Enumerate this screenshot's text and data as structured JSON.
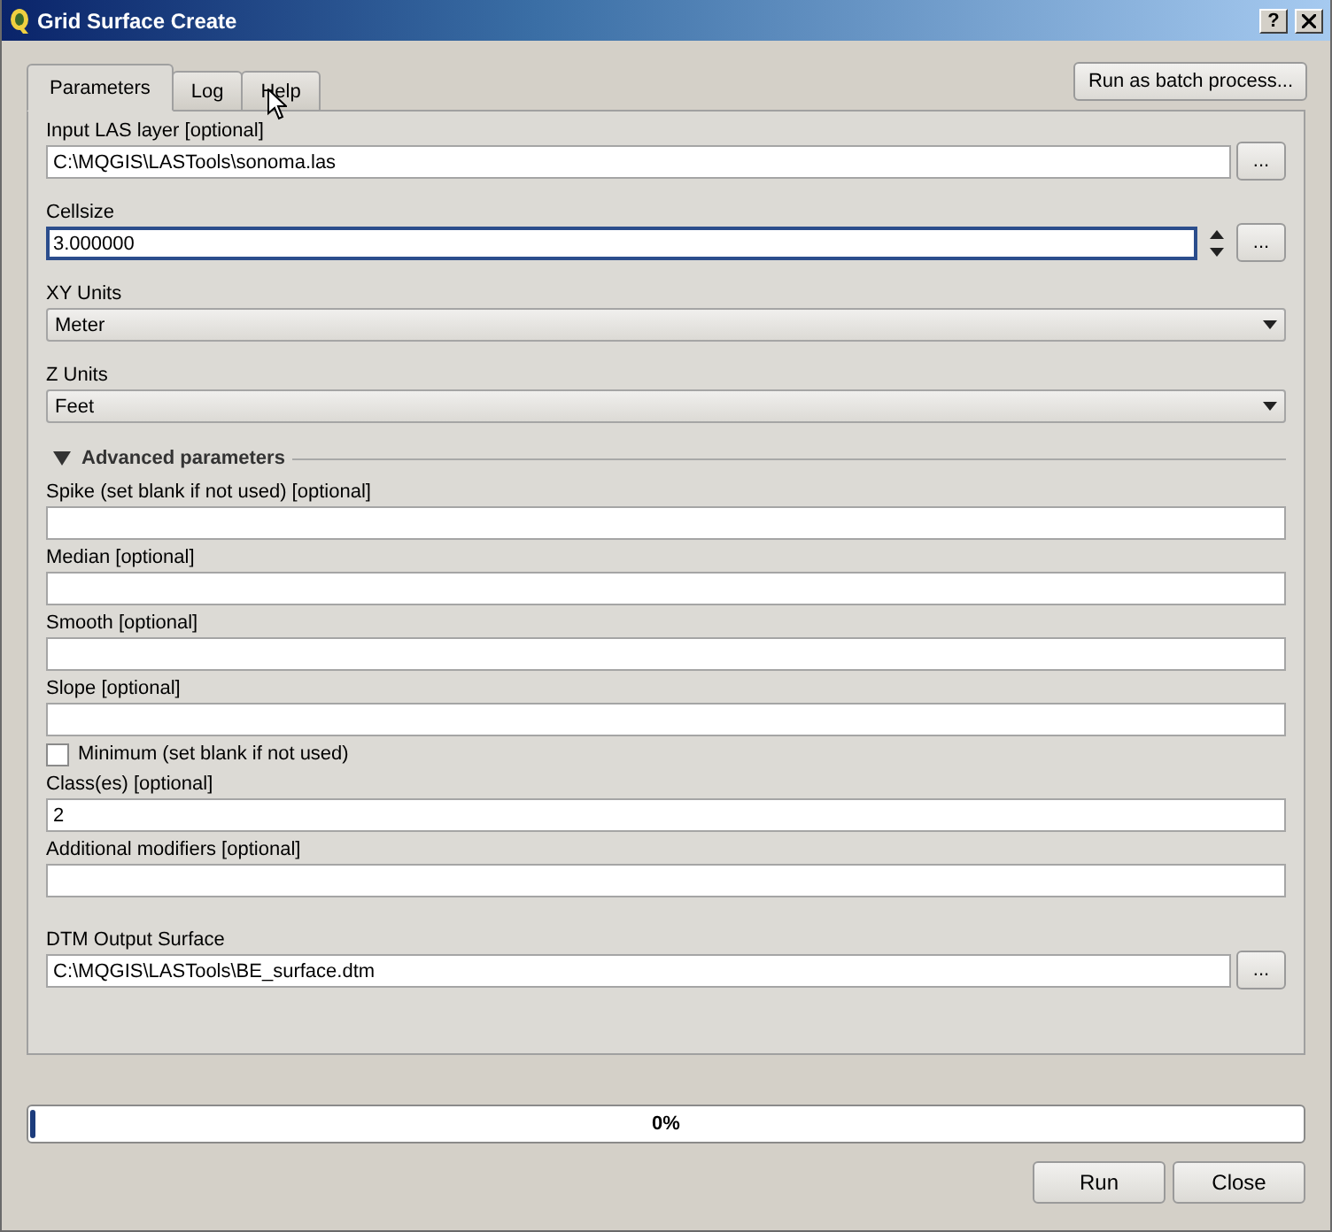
{
  "window": {
    "title": "Grid Surface Create",
    "help_button": "?"
  },
  "tabs": [
    {
      "label": "Parameters",
      "selected": true
    },
    {
      "label": "Log",
      "selected": false
    },
    {
      "label": "Help",
      "selected": false
    }
  ],
  "batch_button": "Run as batch process...",
  "parameters": [
    {
      "kind": "file",
      "label": "Input LAS layer [optional]",
      "value": "C:\\MQGIS\\LASTools\\sonoma.las",
      "browse": "..."
    },
    {
      "kind": "spin",
      "label": "Cellsize",
      "value": "3.000000",
      "focused": true,
      "browse": "..."
    },
    {
      "kind": "combo",
      "label": "XY Units",
      "value": "Meter"
    },
    {
      "kind": "combo",
      "label": "Z Units",
      "value": "Feet"
    },
    {
      "kind": "section",
      "label": "Advanced parameters",
      "expanded": true
    },
    {
      "kind": "text",
      "label": "Spike (set blank if not used) [optional]"
    },
    {
      "kind": "text",
      "label": "Median [optional]"
    },
    {
      "kind": "text",
      "label": "Smooth [optional]"
    },
    {
      "kind": "text",
      "label": "Slope [optional]"
    },
    {
      "kind": "checkbox",
      "label": "Minimum (set blank if not used)",
      "checked": false
    },
    {
      "kind": "text",
      "label": "Class(es) [optional]",
      "value": "2"
    },
    {
      "kind": "text",
      "label": "Additional modifiers [optional]"
    },
    {
      "kind": "file",
      "label": "DTM Output Surface",
      "value": "C:\\MQGIS\\LASTools\\BE_surface.dtm",
      "browse": "..."
    }
  ],
  "progress": {
    "level": 0.004,
    "reading": "0%"
  },
  "buttons": [
    "Run",
    "Close"
  ]
}
